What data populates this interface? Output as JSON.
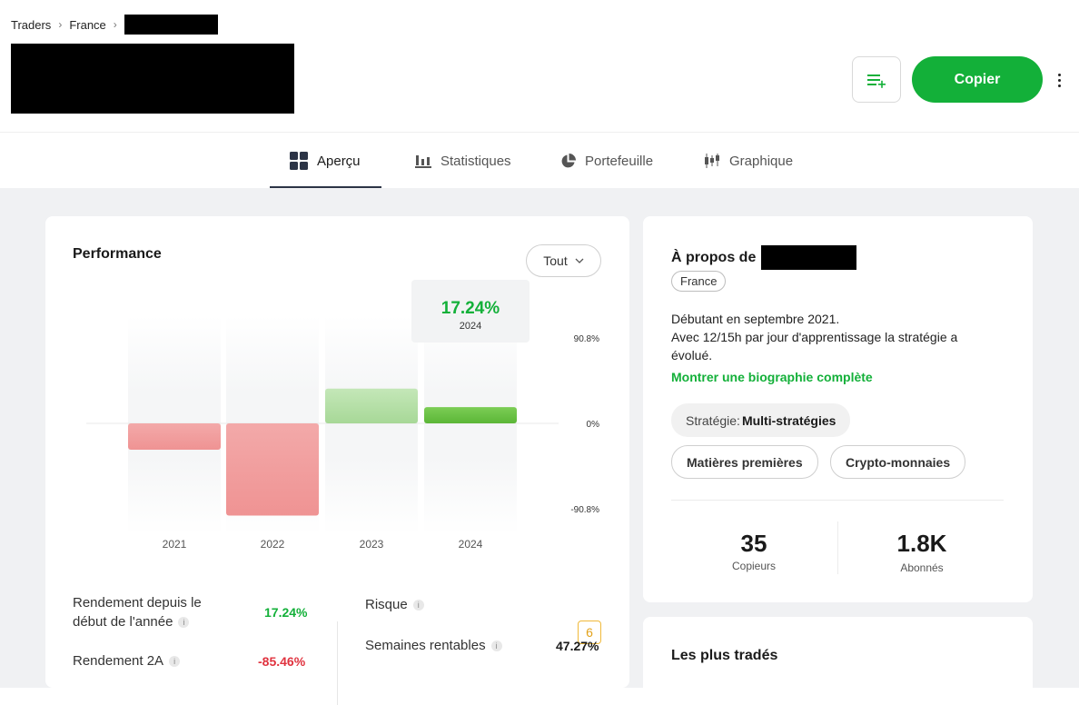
{
  "breadcrumb": {
    "items": [
      "Traders",
      "France"
    ],
    "separator": "›"
  },
  "actions": {
    "watch_icon": "watchlist-add-icon",
    "copy_label": "Copier",
    "more_icon": "more-vertical-icon"
  },
  "tabs": [
    {
      "label": "Aperçu",
      "icon": "grid-icon",
      "active": true
    },
    {
      "label": "Statistiques",
      "icon": "bar-chart-icon",
      "active": false
    },
    {
      "label": "Portefeuille",
      "icon": "pie-chart-icon",
      "active": false
    },
    {
      "label": "Graphique",
      "icon": "candlestick-icon",
      "active": false
    }
  ],
  "performance": {
    "title": "Performance",
    "range_label": "Tout",
    "tooltip": {
      "value": "17.24%",
      "year": "2024"
    },
    "stats": {
      "ytd_label_line1": "Rendement depuis le",
      "ytd_label_line2": "début de l'année",
      "ytd_value": "17.24%",
      "two_year_label": "Rendement 2A",
      "two_year_value": "-85.46%",
      "risk_label": "Risque",
      "risk_value": "6",
      "weeks_label": "Semaines rentables",
      "weeks_value": "47.27%"
    }
  },
  "chart_data": {
    "type": "bar",
    "categories": [
      "2021",
      "2022",
      "2023",
      "2024"
    ],
    "values": [
      -28,
      -98,
      37,
      17.24
    ],
    "ylim": [
      -90.8,
      90.8
    ],
    "y_tick_labels": [
      "90.8%",
      "0%",
      "-90.8%"
    ],
    "colors": {
      "negative": "#f19a9a",
      "positive_past": "#b6e0a8",
      "positive_current": "#6cc04a"
    }
  },
  "about": {
    "title": "À propos de",
    "country": "France",
    "bio_line1": "Débutant en septembre 2021.",
    "bio_line2": "Avec 12/15h par jour d'apprentissage la stratégie a évolué.",
    "bio_link": "Montrer une biographie complète",
    "strategy_prefix": "Stratégie:",
    "strategy_value": "Multi-stratégies",
    "tags": [
      "Matières premières",
      "Crypto-monnaies"
    ],
    "copiers_value": "35",
    "copiers_label": "Copieurs",
    "followers_value": "1.8K",
    "followers_label": "Abonnés"
  },
  "most_traded": {
    "title": "Les plus tradés"
  },
  "colors": {
    "accent_green": "#13b039",
    "negative_red": "#e0333f",
    "risk_yellow": "#f0b93a"
  }
}
